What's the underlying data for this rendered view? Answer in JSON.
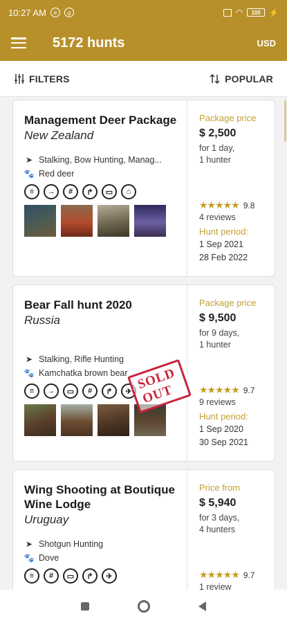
{
  "status": {
    "time": "10:27 AM",
    "battery": "100"
  },
  "appbar": {
    "title": "5172 hunts",
    "currency": "USD"
  },
  "filters": {
    "filters_label": "FILTERS",
    "sort_label": "POPULAR"
  },
  "cards": [
    {
      "title": "Management Deer Package",
      "country": "New Zealand",
      "methods": "Stalking, Bow Hunting, Manag...",
      "animal": "Red deer",
      "feature_icons": [
        "meals-icon",
        "transfer-icon",
        "license-icon",
        "trophy-icon",
        "vehicle-icon",
        "accommodation-icon"
      ],
      "price_label": "Package price",
      "price": "$ 2,500",
      "duration": "for 1 day,",
      "hunters": "1 hunter",
      "stars": "★★★★★",
      "rating": "9.8",
      "reviews": "4 reviews",
      "period_label": "Hunt period:",
      "date_from": "1 Sep 2021",
      "date_to": "28 Feb 2022",
      "sold_out": ""
    },
    {
      "title": "Bear Fall hunt 2020",
      "country": "Russia",
      "methods": "Stalking, Rifle Hunting",
      "animal": "Kamchatka brown bear",
      "feature_icons": [
        "meals-icon",
        "transfer-icon",
        "vehicle-icon",
        "license-icon",
        "trophy-icon",
        "flight-icon"
      ],
      "price_label": "Package price",
      "price": "$ 9,500",
      "duration": "for 9 days,",
      "hunters": "1 hunter",
      "stars": "★★★★★",
      "rating": "9.7",
      "reviews": "9 reviews",
      "period_label": "Hunt period:",
      "date_from": "1 Sep 2020",
      "date_to": "30 Sep 2021",
      "sold_out": "SOLD OUT"
    },
    {
      "title": "Wing Shooting at Boutique Wine Lodge",
      "country": "Uruguay",
      "methods": "Shotgun Hunting",
      "animal": "Dove",
      "feature_icons": [
        "meals-icon",
        "license-icon",
        "vehicle-icon",
        "guide-icon",
        "flight-icon"
      ],
      "price_label": "Price from",
      "price": "$ 5,940",
      "duration": "for 3 days,",
      "hunters": "4 hunters",
      "stars": "★★★★★",
      "rating": "9.7",
      "reviews": "1 review",
      "period_label": "",
      "date_from": "",
      "date_to": "",
      "sold_out": ""
    }
  ],
  "colors": {
    "accent": "#b8902a",
    "gold_text": "#c3a034",
    "sold_out": "#c8243a",
    "star": "#c79b1e"
  }
}
